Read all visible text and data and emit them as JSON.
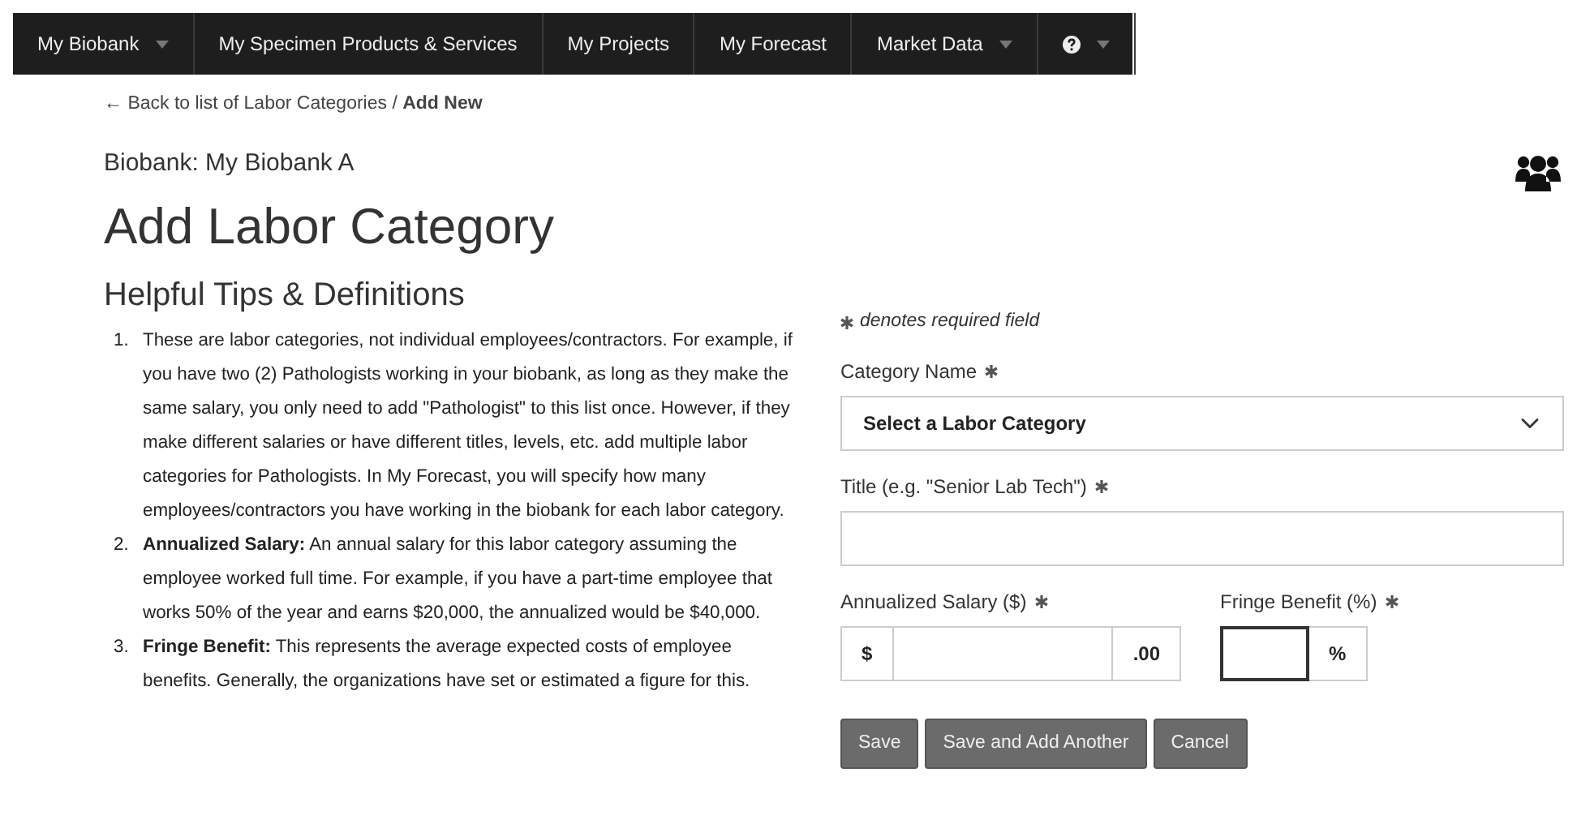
{
  "navbar": {
    "items": [
      {
        "label": "My Biobank",
        "dropdown": true
      },
      {
        "label": "My Specimen Products & Services",
        "dropdown": false
      },
      {
        "label": "My Projects",
        "dropdown": false
      },
      {
        "label": "My Forecast",
        "dropdown": false
      },
      {
        "label": "Market Data",
        "dropdown": true
      },
      {
        "kind": "help",
        "dropdown": true
      }
    ]
  },
  "breadcrumb": {
    "arrow": "←",
    "link": "Back to list of Labor Categories",
    "separator": "/",
    "current": "Add New"
  },
  "biobank": "Biobank: My Biobank A",
  "title": "Add Labor Category",
  "tips": {
    "heading": "Helpful Tips & Definitions",
    "items": [
      {
        "marker": "1.",
        "text": "These are labor categories, not individual employees/contractors. For example, if you have two (2) Pathologists working in your biobank, as long as they make the same salary, you only need to add \"Pathologist\" to this list once. However, if they make different salaries or have different titles, levels, etc. add multiple labor categories for Pathologists. In My Forecast, you will specify how many employees/contractors you have working in the biobank for each labor category."
      },
      {
        "marker": "2.",
        "text": "**Annualized Salary:** An annual salary for this labor category assuming the employee worked full time. For example, if you have a part-time employee that works 50% of the year and earns $20,000, the annualized would be $40,000."
      },
      {
        "marker": "3.",
        "text": "**Fringe Benefit:** This represents the average expected costs of employee benefits. Generally, the organizations have set or estimated a figure for this."
      }
    ]
  },
  "form": {
    "required_note": "denotes required field",
    "category": {
      "label": "Category Name",
      "required": true,
      "value": "Select a Labor Category"
    },
    "title_field": {
      "label": "Title (e.g. \"Senior Lab Tech\")",
      "required": true
    },
    "salary": {
      "label": "Annualized Salary ($)",
      "required": true,
      "prefix": "$",
      "suffix": ".00",
      "focused": false
    },
    "fringe": {
      "label": "Fringe Benefit (%)",
      "required": true,
      "suffix": "%",
      "focused": true
    },
    "buttons": [
      "Save",
      "Save and Add Another",
      "Cancel"
    ]
  }
}
